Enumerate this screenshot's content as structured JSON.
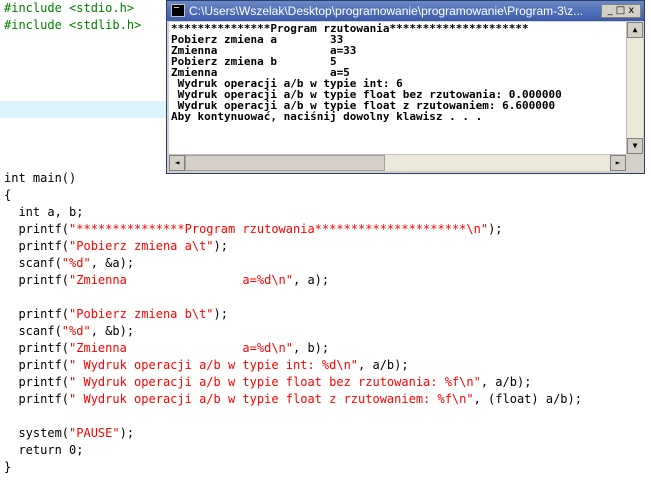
{
  "editor": {
    "includes": [
      "#include <stdio.h>",
      "#include <stdlib.h>"
    ],
    "code": [
      {
        "parts": [
          [
            "kw",
            "int main()"
          ]
        ]
      },
      {
        "parts": [
          [
            "kw",
            "{"
          ]
        ]
      },
      {
        "parts": [
          [
            "kw",
            "  int a, b;"
          ]
        ]
      },
      {
        "parts": [
          [
            "kw",
            "  printf("
          ],
          [
            "str",
            "\"***************Program rzutowania*********************\\n\""
          ],
          [
            "kw",
            ");"
          ]
        ]
      },
      {
        "parts": [
          [
            "kw",
            "  printf("
          ],
          [
            "str",
            "\"Pobierz zmiena a\\t\""
          ],
          [
            "kw",
            ");"
          ]
        ]
      },
      {
        "parts": [
          [
            "kw",
            "  scanf("
          ],
          [
            "str",
            "\"%d\""
          ],
          [
            "kw",
            ", &a);"
          ]
        ]
      },
      {
        "parts": [
          [
            "kw",
            "  printf("
          ],
          [
            "str",
            "\"Zmienna                a=%d\\n\""
          ],
          [
            "kw",
            ", a);"
          ]
        ]
      },
      {
        "parts": [
          [
            "kw",
            ""
          ]
        ]
      },
      {
        "parts": [
          [
            "kw",
            "  printf("
          ],
          [
            "str",
            "\"Pobierz zmiena b\\t\""
          ],
          [
            "kw",
            ");"
          ]
        ]
      },
      {
        "parts": [
          [
            "kw",
            "  scanf("
          ],
          [
            "str",
            "\"%d\""
          ],
          [
            "kw",
            ", &b);"
          ]
        ]
      },
      {
        "parts": [
          [
            "kw",
            "  printf("
          ],
          [
            "str",
            "\"Zmienna                a=%d\\n\""
          ],
          [
            "kw",
            ", b);"
          ]
        ]
      },
      {
        "parts": [
          [
            "kw",
            "  printf("
          ],
          [
            "str",
            "\" Wydruk operacji a/b w typie int: %d\\n\""
          ],
          [
            "kw",
            ", a/b);"
          ]
        ]
      },
      {
        "parts": [
          [
            "kw",
            "  printf("
          ],
          [
            "str",
            "\" Wydruk operacji a/b w typie float bez rzutowania: %f\\n\""
          ],
          [
            "kw",
            ", a/b);"
          ]
        ]
      },
      {
        "parts": [
          [
            "kw",
            "  printf("
          ],
          [
            "str",
            "\" Wydruk operacji a/b w typie float z rzutowaniem: %f\\n\""
          ],
          [
            "kw",
            ", (float) a/b);"
          ]
        ]
      },
      {
        "parts": [
          [
            "kw",
            ""
          ]
        ]
      },
      {
        "parts": [
          [
            "kw",
            "  system("
          ],
          [
            "str",
            "\"PAUSE\""
          ],
          [
            "kw",
            ");"
          ]
        ]
      },
      {
        "parts": [
          [
            "kw",
            "  return "
          ],
          [
            "num",
            "0"
          ],
          [
            "kw",
            ";"
          ]
        ]
      },
      {
        "parts": [
          [
            "kw",
            "}"
          ]
        ]
      }
    ]
  },
  "console": {
    "title": "C:\\Users\\Wszelak\\Desktop\\programowanie\\programowanie\\Program-3\\z...",
    "buttons": "_ □ x",
    "lines": [
      "***************Program rzutowania*********************",
      "Pobierz zmiena a        33",
      "Zmienna                 a=33",
      "Pobierz zmiena b        5",
      "Zmienna                 a=5",
      " Wydruk operacji a/b w typie int: 6",
      " Wydruk operacji a/b w typie float bez rzutowania: 0.000000",
      " Wydruk operacji a/b w typie float z rzutowaniem: 6.600000",
      "Aby kontynuować, naciśnij dowolny klawisz . . ."
    ],
    "scroll_left": "◄",
    "scroll_right": "►",
    "scroll_up": "▲",
    "scroll_down": "▼"
  }
}
